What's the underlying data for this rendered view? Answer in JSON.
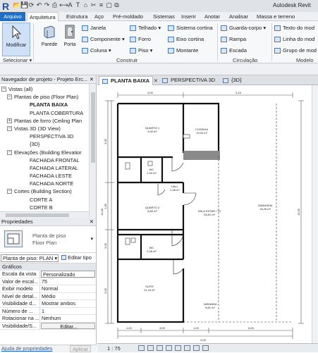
{
  "app": {
    "logo": "R",
    "title": "Autodesk Revit",
    "qat_icons": [
      "open-icon",
      "save-icon",
      "sync-icon",
      "undo-icon",
      "redo-icon",
      "print-icon",
      "measure-icon",
      "annotate-icon",
      "text-icon",
      "3d-view-icon",
      "section-icon",
      "thin-lines-icon",
      "close-hidden-icon",
      "switch-windows-icon"
    ]
  },
  "ribbon_tabs": [
    {
      "label": "Arquivo"
    },
    {
      "label": "Arquitetura"
    },
    {
      "label": "Estrutura"
    },
    {
      "label": "Aço"
    },
    {
      "label": "Pré-moldado"
    },
    {
      "label": "Sistemas"
    },
    {
      "label": "Inserir"
    },
    {
      "label": "Anotar"
    },
    {
      "label": "Analisar"
    },
    {
      "label": "Massa e terreno"
    }
  ],
  "ribbon": {
    "modify_label": "Modificar",
    "select_label": "Selecionar ▾",
    "wall_label": "Parede",
    "door_label": "Porta",
    "build_items": [
      {
        "label": "Janela"
      },
      {
        "label": "Componente ▾"
      },
      {
        "label": "Coluna ▾"
      },
      {
        "label": "Telhado ▾"
      },
      {
        "label": "Forro"
      },
      {
        "label": "Piso ▾"
      },
      {
        "label": "Sistema cortina"
      },
      {
        "label": "Eixo cortina"
      },
      {
        "label": "Montante"
      }
    ],
    "circulation_items": [
      {
        "label": "Guarda-corpo ▾"
      },
      {
        "label": "Rampa"
      },
      {
        "label": "Escada"
      }
    ],
    "model_items": [
      {
        "label": "Texto do mod"
      },
      {
        "label": "Linha do mod"
      },
      {
        "label": "Grupo de mod"
      }
    ],
    "panels": {
      "build": "Construir",
      "circulation": "Circulação",
      "model": "Modelo"
    }
  },
  "project_browser": {
    "title": "Navegador de projeto - Projeto Erc...",
    "close": "✕",
    "items": [
      {
        "label": "Vistas (all)",
        "toggle": "−"
      },
      {
        "label": "Plantas de piso (Floor Plan)",
        "toggle": "−"
      },
      {
        "label": "PLANTA BAIXA",
        "toggle": ""
      },
      {
        "label": "PLANTA COBERTURA",
        "toggle": ""
      },
      {
        "label": "Plantas de forro (Ceiling Plan",
        "toggle": "+"
      },
      {
        "label": "Vistas 3D (3D View)",
        "toggle": "−"
      },
      {
        "label": "PERSPECTIVA 3D",
        "toggle": ""
      },
      {
        "label": "{3D}",
        "toggle": ""
      },
      {
        "label": "Elevações (Building Elevatior",
        "toggle": "−"
      },
      {
        "label": "FACHADA FRONTAL",
        "toggle": ""
      },
      {
        "label": "FACHADA LATERAL",
        "toggle": ""
      },
      {
        "label": "FACHADA LESTE",
        "toggle": ""
      },
      {
        "label": "FACHADA NORTE",
        "toggle": ""
      },
      {
        "label": "Cortes (Building Section)",
        "toggle": "−"
      },
      {
        "label": "CORTE A",
        "toggle": ""
      },
      {
        "label": "CORTE B",
        "toggle": ""
      }
    ]
  },
  "properties": {
    "title": "Propriedades",
    "close": "✕",
    "type_name_line1": "Planta de piso",
    "type_name_line2": "Floor Plan",
    "type_dropdown": "▾",
    "selector": "Planta de piso: PLAN ▾",
    "edit_type": "Editar tipo",
    "group": "Gráficos",
    "rows": [
      {
        "key": "Escala da vista",
        "value": "Personalizado"
      },
      {
        "key": "Valor de escal...",
        "value": "75"
      },
      {
        "key": "Exibir modelo",
        "value": "Normal"
      },
      {
        "key": "Nível de detal...",
        "value": "Médio"
      },
      {
        "key": "Visibilidade d...",
        "value": "Mostrar ambos"
      },
      {
        "key": "Número de ...",
        "value": "1"
      },
      {
        "key": "Rotacionar na ...",
        "value": "Nenhum"
      },
      {
        "key": "Visibilidade/S...",
        "value": "Editar..."
      }
    ],
    "help_link": "Ajuda de propriedades",
    "apply": "Aplicar"
  },
  "view_tabs": [
    {
      "label": "PLANTA BAIXA",
      "active": true
    },
    {
      "label": "PERSPECTIVA 3D",
      "active": false
    },
    {
      "label": "{3D}",
      "active": false
    }
  ],
  "view_bar": {
    "scale": "1 : 75"
  },
  "drawing": {
    "rooms": [
      {
        "name": "QUARTO 1",
        "area": "9,00 m²"
      },
      {
        "name": "COZINHA",
        "area": "10,00 m²"
      },
      {
        "name": "WC",
        "area": "2,34 m²"
      },
      {
        "name": "HALL",
        "area": "1,38 m²"
      },
      {
        "name": "QUARTO 2",
        "area": "8,80 m²"
      },
      {
        "name": "SALA ESTAR / TV",
        "area": "28,81 m²"
      },
      {
        "name": "GARAGEM",
        "area": "18,26 m²"
      },
      {
        "name": "WC",
        "area": "2,28 m²"
      },
      {
        "name": "SUITE",
        "area": "11,44 m²"
      },
      {
        "name": "VARANDA",
        "area": "8,81 m²"
      }
    ],
    "top_dims": [
      "3,00",
      "3,15"
    ],
    "bottom_dims": [
      "1,00",
      "3,00",
      "1,00",
      "6,00"
    ],
    "left_dims": [
      "3,00",
      "1,65",
      "3,00",
      "3,00"
    ],
    "right_dims": [
      "11,05"
    ],
    "total_dims": [
      "11,48",
      "4,00"
    ]
  }
}
